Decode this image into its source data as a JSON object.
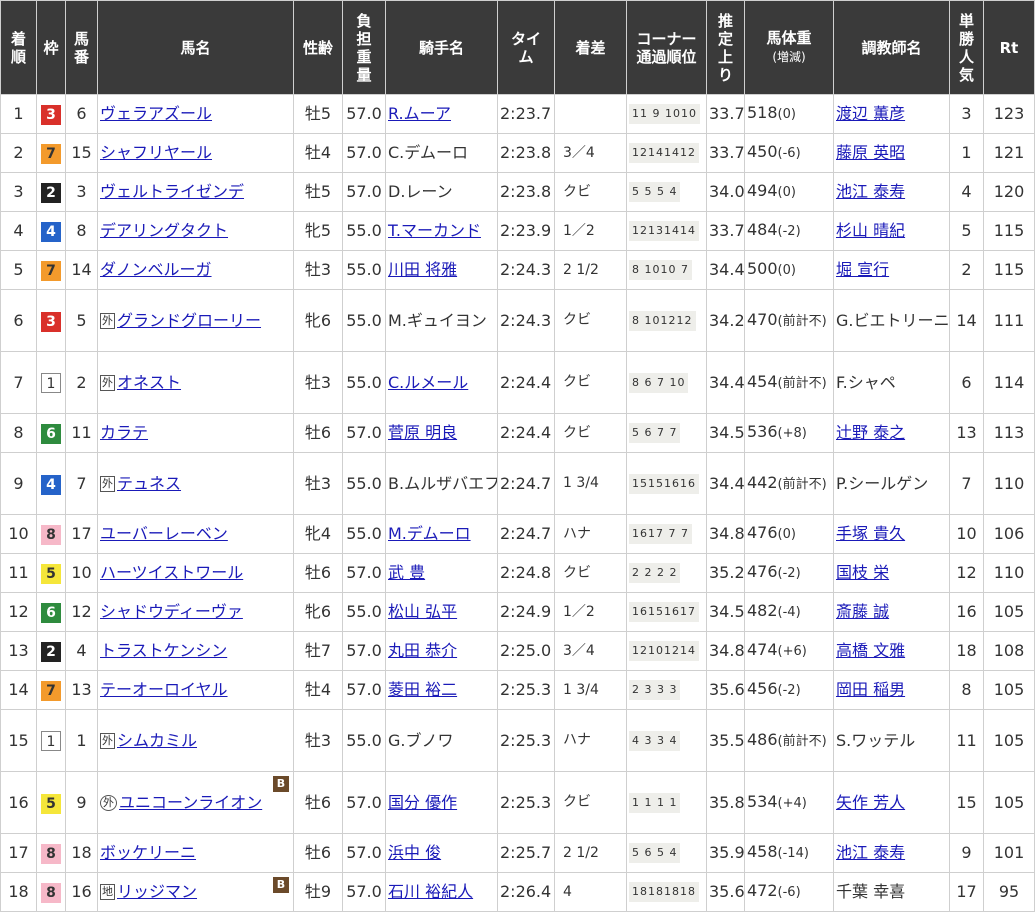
{
  "headers": {
    "rank": "着順",
    "frame": "枠",
    "number": "馬番",
    "horse": "馬名",
    "sex_age": "性齢",
    "weight": "負担重量",
    "jockey": "騎手名",
    "time": "タイム",
    "margin": "着差",
    "corner": "コーナー通過順位",
    "last3f": "推定上り",
    "body_weight": "馬体重",
    "body_weight_sub": "(増減)",
    "trainer": "調教師名",
    "popularity": "単勝人気",
    "rating": "Rt"
  },
  "marks": {
    "foreign": "外",
    "local": "地",
    "blinker": "B"
  },
  "rows": [
    {
      "rank": "1",
      "frame": "3",
      "number": "6",
      "mark": "",
      "horse": "ヴェラアズール",
      "blinker": false,
      "sex_age": "牡5",
      "weight": "57.0",
      "jockey": "R.ムーア",
      "jockey_link": true,
      "time": "2:23.7",
      "margin": "",
      "corner": "11 9 1010",
      "last3f": "33.7",
      "bw": "518",
      "bw_chg": "(0)",
      "trainer": "渡辺 薫彦",
      "trainer_link": true,
      "pop": "3",
      "rt": "123"
    },
    {
      "rank": "2",
      "frame": "7",
      "number": "15",
      "mark": "",
      "horse": "シャフリヤール",
      "blinker": false,
      "sex_age": "牡4",
      "weight": "57.0",
      "jockey": "C.デムーロ",
      "jockey_link": false,
      "time": "2:23.8",
      "margin": "3／4",
      "corner": "12141412",
      "last3f": "33.7",
      "bw": "450",
      "bw_chg": "(-6)",
      "trainer": "藤原 英昭",
      "trainer_link": true,
      "pop": "1",
      "rt": "121"
    },
    {
      "rank": "3",
      "frame": "2",
      "number": "3",
      "mark": "",
      "horse": "ヴェルトライゼンデ",
      "blinker": false,
      "sex_age": "牡5",
      "weight": "57.0",
      "jockey": "D.レーン",
      "jockey_link": false,
      "time": "2:23.8",
      "margin": "クビ",
      "corner": "5 5 5 4",
      "last3f": "34.0",
      "bw": "494",
      "bw_chg": "(0)",
      "trainer": "池江 泰寿",
      "trainer_link": true,
      "pop": "4",
      "rt": "120"
    },
    {
      "rank": "4",
      "frame": "4",
      "number": "8",
      "mark": "",
      "horse": "デアリングタクト",
      "blinker": false,
      "sex_age": "牝5",
      "weight": "55.0",
      "jockey": "T.マーカンド",
      "jockey_link": true,
      "time": "2:23.9",
      "margin": "1／2",
      "corner": "12131414",
      "last3f": "33.7",
      "bw": "484",
      "bw_chg": "(-2)",
      "trainer": "杉山 晴紀",
      "trainer_link": true,
      "pop": "5",
      "rt": "115"
    },
    {
      "rank": "5",
      "frame": "7",
      "number": "14",
      "mark": "",
      "horse": "ダノンベルーガ",
      "blinker": false,
      "sex_age": "牡3",
      "weight": "55.0",
      "jockey": "川田 将雅",
      "jockey_link": true,
      "time": "2:24.3",
      "margin": "2 1/2",
      "corner": "8 1010 7",
      "last3f": "34.4",
      "bw": "500",
      "bw_chg": "(0)",
      "trainer": "堀 宣行",
      "trainer_link": true,
      "pop": "2",
      "rt": "115"
    },
    {
      "rank": "6",
      "frame": "3",
      "number": "5",
      "mark": "外",
      "horse": "グランドグローリー",
      "blinker": false,
      "sex_age": "牝6",
      "weight": "55.0",
      "jockey": "M.ギュイヨン",
      "jockey_link": false,
      "time": "2:24.3",
      "margin": "クビ",
      "corner": "8 101212",
      "last3f": "34.2",
      "bw": "470",
      "bw_chg": "(前計不)",
      "trainer": "G.ビエトリーニ",
      "trainer_link": false,
      "pop": "14",
      "rt": "111"
    },
    {
      "rank": "7",
      "frame": "1",
      "number": "2",
      "mark": "外",
      "horse": "オネスト",
      "blinker": false,
      "sex_age": "牡3",
      "weight": "55.0",
      "jockey": "C.ルメール",
      "jockey_link": true,
      "time": "2:24.4",
      "margin": "クビ",
      "corner": "8 6 7 10",
      "last3f": "34.4",
      "bw": "454",
      "bw_chg": "(前計不)",
      "trainer": "F.シャペ",
      "trainer_link": false,
      "pop": "6",
      "rt": "114"
    },
    {
      "rank": "8",
      "frame": "6",
      "number": "11",
      "mark": "",
      "horse": "カラテ",
      "blinker": false,
      "sex_age": "牡6",
      "weight": "57.0",
      "jockey": "菅原 明良",
      "jockey_link": true,
      "time": "2:24.4",
      "margin": "クビ",
      "corner": "5 6 7 7",
      "last3f": "34.5",
      "bw": "536",
      "bw_chg": "(+8)",
      "trainer": "辻野 泰之",
      "trainer_link": true,
      "pop": "13",
      "rt": "113"
    },
    {
      "rank": "9",
      "frame": "4",
      "number": "7",
      "mark": "外",
      "horse": "テュネス",
      "blinker": false,
      "sex_age": "牡3",
      "weight": "55.0",
      "jockey": "B.ムルザバエフ",
      "jockey_link": false,
      "time": "2:24.7",
      "margin": "1 3/4",
      "corner": "15151616",
      "last3f": "34.4",
      "bw": "442",
      "bw_chg": "(前計不)",
      "trainer": "P.シールゲン",
      "trainer_link": false,
      "pop": "7",
      "rt": "110"
    },
    {
      "rank": "10",
      "frame": "8",
      "number": "17",
      "mark": "",
      "horse": "ユーバーレーベン",
      "blinker": false,
      "sex_age": "牝4",
      "weight": "55.0",
      "jockey": "M.デムーロ",
      "jockey_link": true,
      "time": "2:24.7",
      "margin": "ハナ",
      "corner": "1617 7 7",
      "last3f": "34.8",
      "bw": "476",
      "bw_chg": "(0)",
      "trainer": "手塚 貴久",
      "trainer_link": true,
      "pop": "10",
      "rt": "106"
    },
    {
      "rank": "11",
      "frame": "5",
      "number": "10",
      "mark": "",
      "horse": "ハーツイストワール",
      "blinker": false,
      "sex_age": "牡6",
      "weight": "57.0",
      "jockey": "武 豊",
      "jockey_link": true,
      "time": "2:24.8",
      "margin": "クビ",
      "corner": "2 2 2 2",
      "last3f": "35.2",
      "bw": "476",
      "bw_chg": "(-2)",
      "trainer": "国枝 栄",
      "trainer_link": true,
      "pop": "12",
      "rt": "110"
    },
    {
      "rank": "12",
      "frame": "6",
      "number": "12",
      "mark": "",
      "horse": "シャドウディーヴァ",
      "blinker": false,
      "sex_age": "牝6",
      "weight": "55.0",
      "jockey": "松山 弘平",
      "jockey_link": true,
      "time": "2:24.9",
      "margin": "1／2",
      "corner": "16151617",
      "last3f": "34.5",
      "bw": "482",
      "bw_chg": "(-4)",
      "trainer": "斎藤 誠",
      "trainer_link": true,
      "pop": "16",
      "rt": "105"
    },
    {
      "rank": "13",
      "frame": "2",
      "number": "4",
      "mark": "",
      "horse": "トラストケンシン",
      "blinker": false,
      "sex_age": "牡7",
      "weight": "57.0",
      "jockey": "丸田 恭介",
      "jockey_link": true,
      "time": "2:25.0",
      "margin": "3／4",
      "corner": "12101214",
      "last3f": "34.8",
      "bw": "474",
      "bw_chg": "(+6)",
      "trainer": "高橋 文雅",
      "trainer_link": true,
      "pop": "18",
      "rt": "108"
    },
    {
      "rank": "14",
      "frame": "7",
      "number": "13",
      "mark": "",
      "horse": "テーオーロイヤル",
      "blinker": false,
      "sex_age": "牡4",
      "weight": "57.0",
      "jockey": "菱田 裕二",
      "jockey_link": true,
      "time": "2:25.3",
      "margin": "1 3/4",
      "corner": "2 3 3 3",
      "last3f": "35.6",
      "bw": "456",
      "bw_chg": "(-2)",
      "trainer": "岡田 稲男",
      "trainer_link": true,
      "pop": "8",
      "rt": "105"
    },
    {
      "rank": "15",
      "frame": "1",
      "number": "1",
      "mark": "外",
      "horse": "シムカミル",
      "blinker": false,
      "sex_age": "牡3",
      "weight": "55.0",
      "jockey": "G.ブノワ",
      "jockey_link": false,
      "time": "2:25.3",
      "margin": "ハナ",
      "corner": "4 3 3 4",
      "last3f": "35.5",
      "bw": "486",
      "bw_chg": "(前計不)",
      "trainer": "S.ワッテル",
      "trainer_link": false,
      "pop": "11",
      "rt": "105"
    },
    {
      "rank": "16",
      "frame": "5",
      "number": "9",
      "mark": "外",
      "horse": "ユニコーンライオン",
      "blinker": true,
      "sex_age": "牡6",
      "weight": "57.0",
      "jockey": "国分 優作",
      "jockey_link": true,
      "time": "2:25.3",
      "margin": "クビ",
      "corner": "1 1 1 1",
      "last3f": "35.8",
      "bw": "534",
      "bw_chg": "(+4)",
      "trainer": "矢作 芳人",
      "trainer_link": true,
      "pop": "15",
      "rt": "105"
    },
    {
      "rank": "17",
      "frame": "8",
      "number": "18",
      "mark": "",
      "horse": "ボッケリーニ",
      "blinker": false,
      "sex_age": "牡6",
      "weight": "57.0",
      "jockey": "浜中 俊",
      "jockey_link": true,
      "time": "2:25.7",
      "margin": "2 1/2",
      "corner": "5 6 5 4",
      "last3f": "35.9",
      "bw": "458",
      "bw_chg": "(-14)",
      "trainer": "池江 泰寿",
      "trainer_link": true,
      "pop": "9",
      "rt": "101"
    },
    {
      "rank": "18",
      "frame": "8",
      "number": "16",
      "mark": "地",
      "horse": "リッジマン",
      "blinker": true,
      "sex_age": "牡9",
      "weight": "57.0",
      "jockey": "石川 裕紀人",
      "jockey_link": true,
      "time": "2:26.4",
      "margin": "4",
      "corner": "18181818",
      "last3f": "35.6",
      "bw": "472",
      "bw_chg": "(-6)",
      "trainer": "千葉 幸喜",
      "trainer_link": false,
      "pop": "17",
      "rt": "95"
    }
  ]
}
